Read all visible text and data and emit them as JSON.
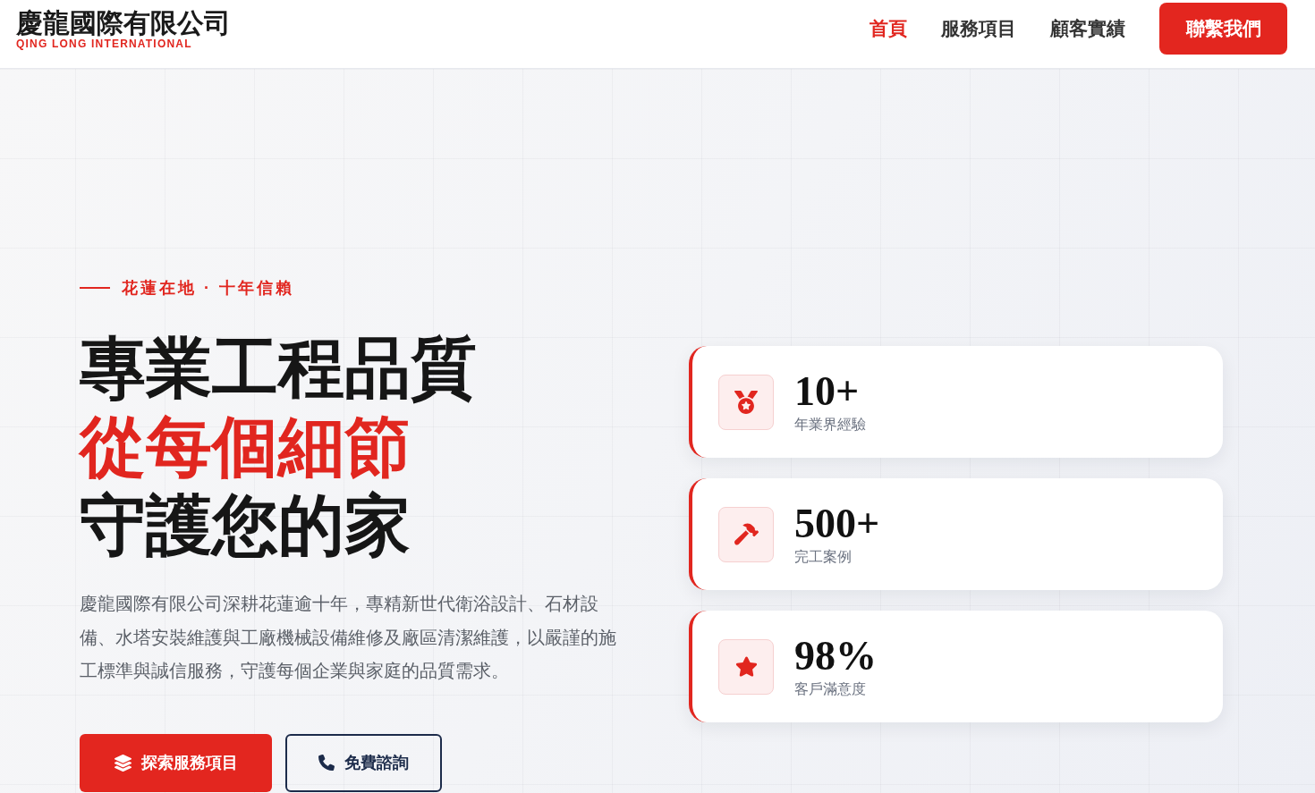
{
  "header": {
    "logo": {
      "title": "慶龍國際有限公司",
      "subtitle": "QING LONG INTERNATIONAL"
    },
    "nav": [
      {
        "label": "首頁",
        "selected": true
      },
      {
        "label": "服務項目",
        "selected": false
      },
      {
        "label": "顧客實績",
        "selected": false
      }
    ],
    "cta_button": "聯繫我們"
  },
  "hero": {
    "tagline": "花蓮在地 · 十年信賴",
    "heading": [
      {
        "text": "專業工程品質",
        "highlight": false
      },
      {
        "text": "從每個細節",
        "highlight": true
      },
      {
        "text": "守護您的家",
        "highlight": false
      }
    ],
    "description": "慶龍國際有限公司深耕花蓮逾十年，專精新世代衛浴設計、石材設備、水塔安裝維護與工廠機械設備維修及廠區清潔維護，以嚴謹的施工標準與誠信服務，守護每個企業與家庭的品質需求。",
    "buttons": [
      {
        "label": "探索服務項目",
        "kind": "primary"
      },
      {
        "label": "免費諮詢",
        "kind": "outline"
      }
    ],
    "stats": [
      {
        "value": "10+",
        "label": "年業界經驗"
      },
      {
        "value": "500+",
        "label": "完工案例"
      },
      {
        "value": "98%",
        "label": "客戶滿意度"
      }
    ]
  }
}
